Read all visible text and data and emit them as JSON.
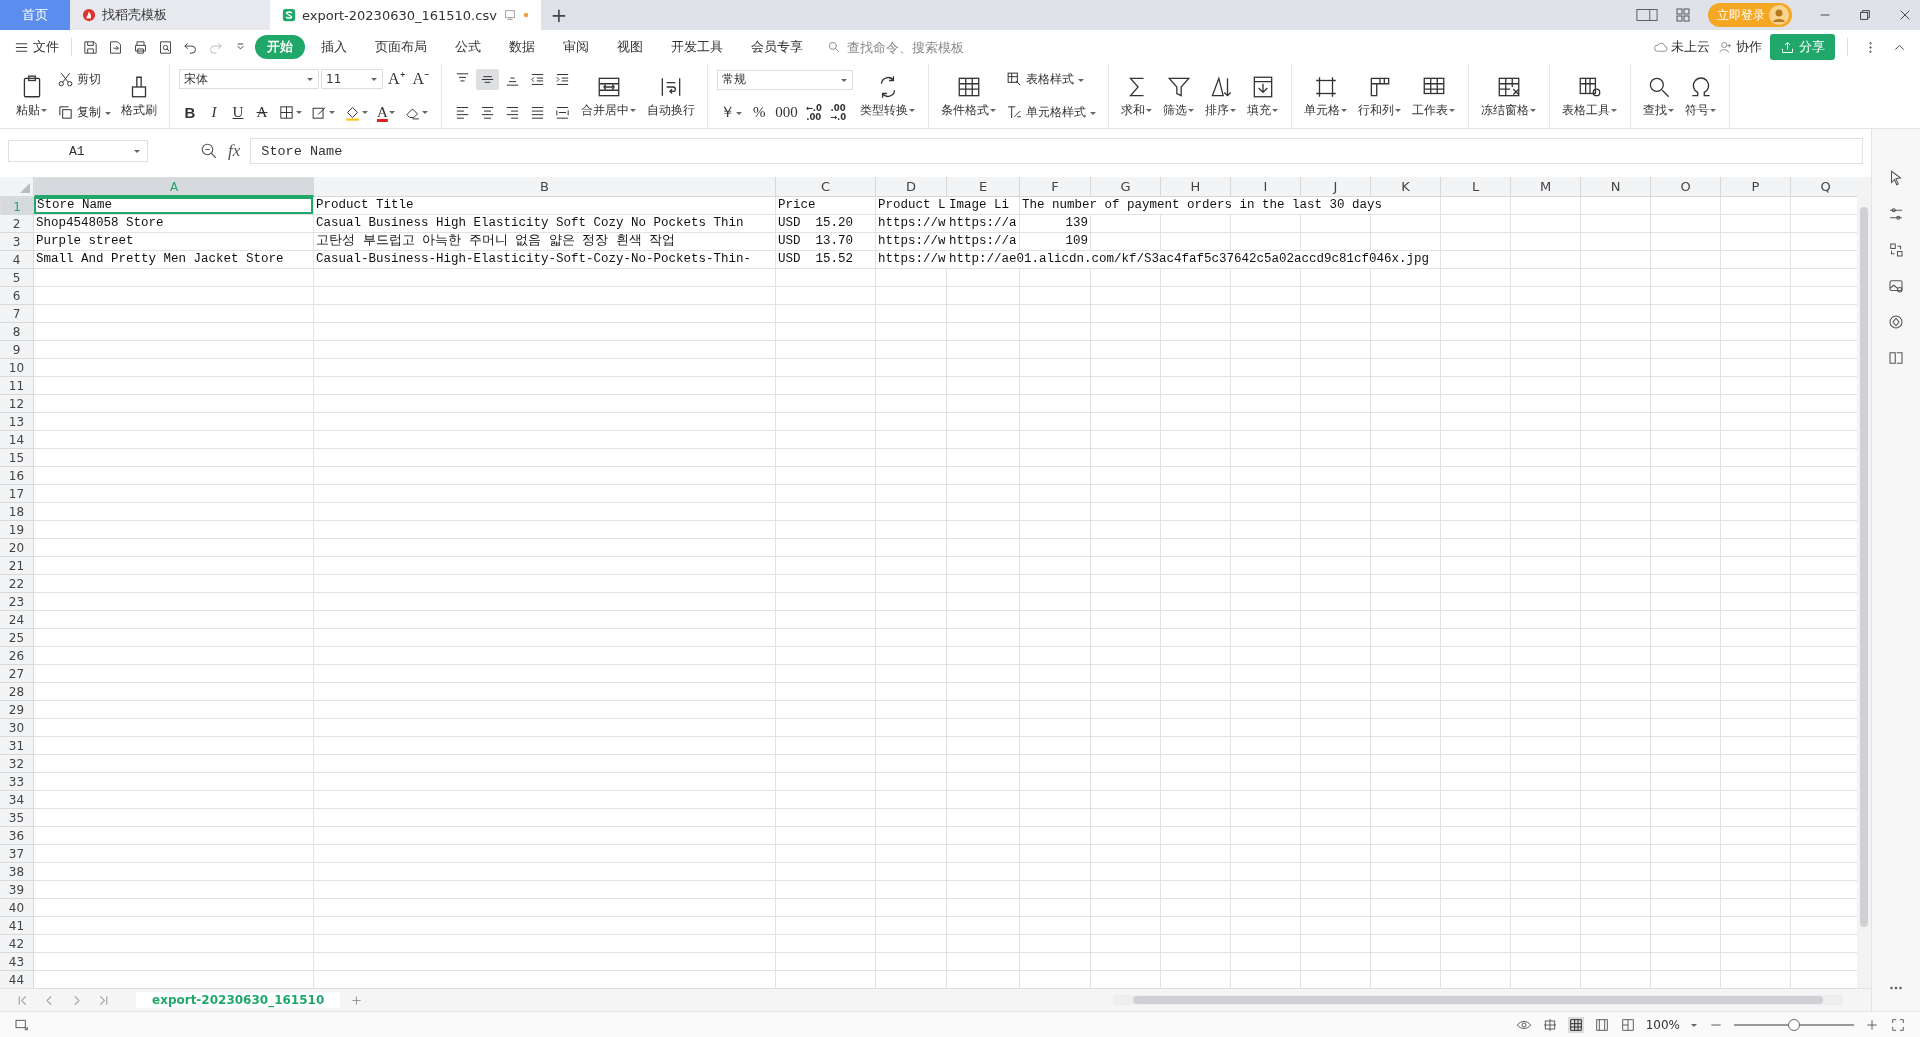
{
  "tabs": [
    {
      "label": "首页",
      "kind": "home",
      "selected": false
    },
    {
      "label": "找稻壳模板",
      "kind": "docer",
      "selected": false
    },
    {
      "label": "export-20230630_161510.csv",
      "kind": "sheet",
      "selected": true
    }
  ],
  "new_tab": "+",
  "login": "立即登录",
  "file_menu": "文件",
  "ribbon_tabs": [
    {
      "label": "开始",
      "selected": true
    },
    {
      "label": "插入",
      "selected": false
    },
    {
      "label": "页面布局",
      "selected": false
    },
    {
      "label": "公式",
      "selected": false
    },
    {
      "label": "数据",
      "selected": false
    },
    {
      "label": "审阅",
      "selected": false
    },
    {
      "label": "视图",
      "selected": false
    },
    {
      "label": "开发工具",
      "selected": false
    },
    {
      "label": "会员专享",
      "selected": false
    }
  ],
  "search": {
    "placeholder": "查找命令、搜索模板"
  },
  "cloud": "未上云",
  "collab": "协作",
  "share": "分享",
  "ribbon": [
    {
      "columns": [
        [
          [
            {
              "kind": "large",
              "label": "粘贴",
              "dropdown": true
            }
          ]
        ],
        [
          [
            {
              "kind": "small",
              "label": "剪切",
              "dropdown": false
            }
          ],
          [
            {
              "kind": "small",
              "label": "复制",
              "dropdown": true
            }
          ]
        ],
        [
          [
            {
              "kind": "large",
              "label": "格式刷",
              "dropdown": false
            }
          ]
        ]
      ]
    },
    {
      "columns": [
        [
          [
            {
              "kind": "select",
              "value": "宋体"
            },
            {
              "kind": "select",
              "value": "11"
            },
            {
              "kind": "glyph",
              "text": "A⁺",
              "dropdown": false
            },
            {
              "kind": "glyph",
              "text": "A⁻",
              "dropdown": false
            }
          ],
          [
            {
              "kind": "glyph",
              "text": "B",
              "dropdown": false
            },
            {
              "kind": "glyph",
              "text": "I",
              "dropdown": false
            },
            {
              "kind": "glyph",
              "text": "U",
              "dropdown": false
            },
            {
              "kind": "glyph",
              "text": "A",
              "dropdown": false
            },
            {
              "kind": "icon",
              "dropdown": true
            },
            {
              "kind": "icon",
              "dropdown": true
            },
            {
              "kind": "icon",
              "dropdown": true
            },
            {
              "kind": "glyph",
              "text": "A",
              "dropdown": true
            },
            {
              "kind": "icon",
              "dropdown": true
            }
          ]
        ]
      ]
    },
    {
      "columns": [
        [
          [
            {
              "kind": "icon",
              "dropdown": false,
              "on": false
            },
            {
              "kind": "icon",
              "dropdown": false,
              "on": true
            },
            {
              "kind": "icon",
              "dropdown": false,
              "on": false
            },
            {
              "kind": "icon",
              "dropdown": false,
              "on": false
            },
            {
              "kind": "icon",
              "dropdown": false,
              "on": false
            }
          ],
          [
            {
              "kind": "icon",
              "dropdown": false,
              "on": false
            },
            {
              "kind": "icon",
              "dropdown": false,
              "on": false
            },
            {
              "kind": "icon",
              "dropdown": false,
              "on": false
            },
            {
              "kind": "icon",
              "dropdown": false,
              "on": false
            },
            {
              "kind": "icon",
              "dropdown": false,
              "on": false
            }
          ]
        ],
        [
          [
            {
              "kind": "large",
              "label": "合并居中",
              "dropdown": true
            }
          ]
        ],
        [
          [
            {
              "kind": "large",
              "label": "自动换行",
              "dropdown": false
            }
          ]
        ]
      ]
    },
    {
      "columns": [
        [
          [
            {
              "kind": "select",
              "value": "常规"
            }
          ],
          [
            {
              "kind": "glyph",
              "text": "￥",
              "dropdown": true
            },
            {
              "kind": "glyph",
              "text": "%",
              "dropdown": false
            },
            {
              "kind": "glyph",
              "text": "000",
              "dropdown": false
            },
            {
              "kind": "glyph",
              "text": "←.0\n.00",
              "dropdown": false
            },
            {
              "kind": "glyph",
              "text": ".00\n→.0",
              "dropdown": false
            }
          ]
        ],
        [
          [
            {
              "kind": "large",
              "label": "类型转换",
              "dropdown": true
            }
          ]
        ]
      ]
    },
    {
      "columns": [
        [
          [
            {
              "kind": "large",
              "label": "条件格式",
              "dropdown": true
            }
          ]
        ],
        [
          [
            {
              "kind": "small",
              "label": "表格样式",
              "dropdown": true
            }
          ],
          [
            {
              "kind": "small",
              "label": "单元格样式",
              "dropdown": true
            }
          ]
        ]
      ]
    },
    {
      "columns": [
        [
          [
            {
              "kind": "large",
              "label": "求和",
              "dropdown": true
            }
          ]
        ],
        [
          [
            {
              "kind": "large",
              "label": "筛选",
              "dropdown": true
            }
          ]
        ],
        [
          [
            {
              "kind": "large",
              "label": "排序",
              "dropdown": true
            }
          ]
        ],
        [
          [
            {
              "kind": "large",
              "label": "填充",
              "dropdown": true
            }
          ]
        ]
      ]
    },
    {
      "columns": [
        [
          [
            {
              "kind": "large",
              "label": "单元格",
              "dropdown": true
            }
          ]
        ],
        [
          [
            {
              "kind": "large",
              "label": "行和列",
              "dropdown": true
            }
          ]
        ],
        [
          [
            {
              "kind": "large",
              "label": "工作表",
              "dropdown": true
            }
          ]
        ]
      ]
    },
    {
      "columns": [
        [
          [
            {
              "kind": "large",
              "label": "冻结窗格",
              "dropdown": true
            }
          ]
        ]
      ]
    },
    {
      "columns": [
        [
          [
            {
              "kind": "large",
              "label": "表格工具",
              "dropdown": true
            }
          ]
        ]
      ]
    },
    {
      "columns": [
        [
          [
            {
              "kind": "large",
              "label": "查找",
              "dropdown": true
            }
          ]
        ],
        [
          [
            {
              "kind": "large",
              "label": "符号",
              "dropdown": true
            }
          ]
        ]
      ]
    }
  ],
  "name_box": "A1",
  "fx": "fx",
  "formula": "Store Name",
  "columns": [
    {
      "label": "A",
      "selected": true
    },
    {
      "label": "B",
      "selected": false
    },
    {
      "label": "C",
      "selected": false
    },
    {
      "label": "D",
      "selected": false
    },
    {
      "label": "E",
      "selected": false
    },
    {
      "label": "F",
      "selected": false
    },
    {
      "label": "G",
      "selected": false
    },
    {
      "label": "H",
      "selected": false
    },
    {
      "label": "I",
      "selected": false
    },
    {
      "label": "J",
      "selected": false
    },
    {
      "label": "K",
      "selected": false
    },
    {
      "label": "L",
      "selected": false
    },
    {
      "label": "M",
      "selected": false
    },
    {
      "label": "N",
      "selected": false
    },
    {
      "label": "O",
      "selected": false
    },
    {
      "label": "P",
      "selected": false
    },
    {
      "label": "Q",
      "selected": false
    }
  ],
  "rows": [
    {
      "label": "1",
      "selected": true,
      "cells": [
        {
          "text": "Store Name",
          "kind": "text",
          "selected": true
        },
        {
          "text": "Product Title",
          "kind": "text",
          "selected": false
        },
        {
          "text": "Price",
          "kind": "text",
          "selected": false
        },
        {
          "text": "Product L",
          "kind": "text",
          "selected": false
        },
        {
          "text": "Image Li",
          "kind": "text",
          "selected": false
        },
        {
          "text": "The number of payment orders in the last 30 days",
          "kind": "text",
          "selected": false
        }
      ]
    },
    {
      "label": "2",
      "selected": false,
      "cells": [
        {
          "text": "Shop4548058 Store",
          "kind": "text",
          "selected": false
        },
        {
          "text": "Casual Business High Elasticity Soft Cozy No Pockets Thin",
          "kind": "text",
          "selected": false
        },
        {
          "text": "USD  15.20",
          "kind": "text",
          "selected": false
        },
        {
          "text": "https://w",
          "kind": "text",
          "selected": false
        },
        {
          "text": "https://a",
          "kind": "text",
          "selected": false
        },
        {
          "text": "139",
          "kind": "number",
          "selected": false
        }
      ]
    },
    {
      "label": "3",
      "selected": false,
      "cells": [
        {
          "text": "Purple street",
          "kind": "text",
          "selected": false
        },
        {
          "text": "고탄성 부드럽고 아늑한 주머니 없음 얇은 정장 흰색 작업",
          "kind": "text",
          "selected": false
        },
        {
          "text": "USD  13.70",
          "kind": "text",
          "selected": false
        },
        {
          "text": "https://w",
          "kind": "text",
          "selected": false
        },
        {
          "text": "https://a",
          "kind": "text",
          "selected": false
        },
        {
          "text": "109",
          "kind": "number",
          "selected": false
        }
      ]
    },
    {
      "label": "4",
      "selected": false,
      "cells": [
        {
          "text": "Small And Pretty Men Jacket Store",
          "kind": "text",
          "selected": false
        },
        {
          "text": "Casual-Business-High-Elasticity-Soft-Cozy-No-Pockets-Thin-",
          "kind": "text",
          "selected": false
        },
        {
          "text": "USD  15.52",
          "kind": "text",
          "selected": false
        },
        {
          "text": "https://w",
          "kind": "text",
          "selected": false
        },
        {
          "text": "http://ae01.alicdn.com/kf/S3ac4faf5c37642c5a02accd9c81cf046x.jpg",
          "kind": "text",
          "selected": false
        }
      ]
    },
    {
      "label": "5",
      "selected": false
    },
    {
      "label": "6",
      "selected": false
    },
    {
      "label": "7",
      "selected": false
    },
    {
      "label": "8",
      "selected": false
    },
    {
      "label": "9",
      "selected": false
    },
    {
      "label": "10",
      "selected": false
    },
    {
      "label": "11",
      "selected": false
    },
    {
      "label": "12",
      "selected": false
    },
    {
      "label": "13",
      "selected": false
    },
    {
      "label": "14",
      "selected": false
    },
    {
      "label": "15",
      "selected": false
    },
    {
      "label": "16",
      "selected": false
    },
    {
      "label": "17",
      "selected": false
    },
    {
      "label": "18",
      "selected": false
    },
    {
      "label": "19",
      "selected": false
    },
    {
      "label": "20",
      "selected": false
    },
    {
      "label": "21",
      "selected": false
    },
    {
      "label": "22",
      "selected": false
    },
    {
      "label": "23",
      "selected": false
    },
    {
      "label": "24",
      "selected": false
    },
    {
      "label": "25",
      "selected": false
    },
    {
      "label": "26",
      "selected": false
    },
    {
      "label": "27",
      "selected": false
    },
    {
      "label": "28",
      "selected": false
    },
    {
      "label": "29",
      "selected": false
    },
    {
      "label": "30",
      "selected": false
    },
    {
      "label": "31",
      "selected": false
    },
    {
      "label": "32",
      "selected": false
    },
    {
      "label": "33",
      "selected": false
    },
    {
      "label": "34",
      "selected": false
    },
    {
      "label": "35",
      "selected": false
    },
    {
      "label": "36",
      "selected": false
    },
    {
      "label": "37",
      "selected": false
    },
    {
      "label": "38",
      "selected": false
    },
    {
      "label": "39",
      "selected": false
    },
    {
      "label": "40",
      "selected": false
    },
    {
      "label": "41",
      "selected": false
    },
    {
      "label": "42",
      "selected": false
    },
    {
      "label": "43",
      "selected": false
    },
    {
      "label": "44",
      "selected": false
    }
  ],
  "sheet_tab": {
    "label": "export-20230630_161510",
    "selected": true
  },
  "views": [
    {
      "selected": true
    },
    {
      "selected": false
    },
    {
      "selected": false
    }
  ],
  "zoom": "100%",
  "zoom_slider": {
    "level": 0.5
  }
}
